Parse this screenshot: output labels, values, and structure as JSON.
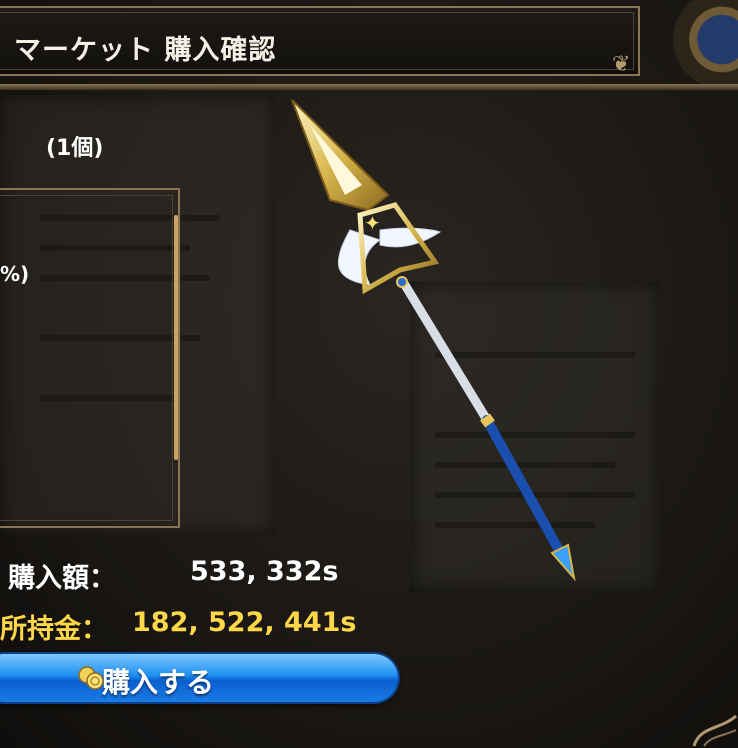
{
  "header": {
    "title": "マーケット 購入確認"
  },
  "item": {
    "quantity": "(1個)",
    "percent_fragment": "%)"
  },
  "purchase": {
    "price_label": "購入額：",
    "price_value": "533, 332s",
    "balance_label": "所持金：",
    "balance_value": "182, 522, 441s"
  },
  "buy_button": {
    "label": "購入する",
    "icon": "coins-icon"
  },
  "colors": {
    "frame": "#8a7454",
    "balance_text": "#ffd84a",
    "button_blue": "#1f8ff0"
  }
}
